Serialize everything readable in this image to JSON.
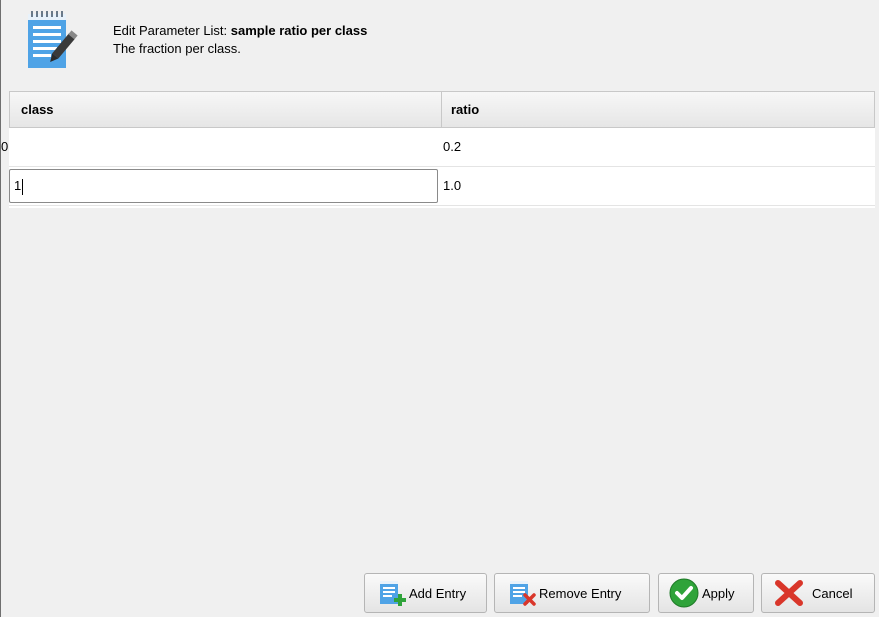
{
  "header": {
    "title_prefix": "Edit Parameter List: ",
    "title_name": "sample ratio per class",
    "subtitle": "The fraction per class."
  },
  "table": {
    "columns": [
      "class",
      "ratio"
    ],
    "rows": [
      {
        "class": "0",
        "ratio": "0.2"
      },
      {
        "class": "1",
        "ratio": "1.0"
      }
    ]
  },
  "buttons": {
    "add": "Add Entry",
    "remove": "Remove Entry",
    "apply": "Apply",
    "cancel": "Cancel"
  },
  "icons": {
    "header": "document-edit-icon",
    "add": "document-add-icon",
    "remove": "document-remove-icon",
    "apply": "checkmark-icon",
    "cancel": "cross-icon"
  },
  "colors": {
    "accent_blue": "#3b8fd6",
    "apply_green": "#2fa33a",
    "cancel_red": "#d9362a"
  }
}
